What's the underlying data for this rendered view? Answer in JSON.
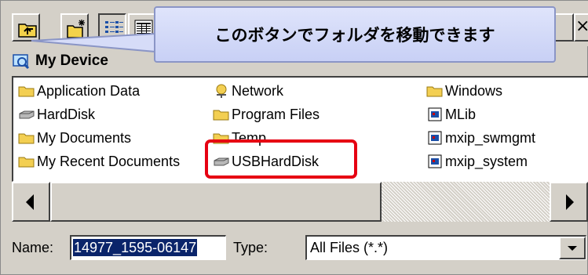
{
  "toolbar": {
    "buttons": [
      "up-folder-icon",
      "new-folder-icon",
      "list-view-icon",
      "details-view-icon"
    ],
    "close_label": "×"
  },
  "location": {
    "label": "My Device",
    "icon": "device-icon"
  },
  "files": [
    {
      "name": "Application Data",
      "icon": "folder-icon"
    },
    {
      "name": "HardDisk",
      "icon": "drive-icon"
    },
    {
      "name": "My Documents",
      "icon": "folder-icon"
    },
    {
      "name": "My Recent Documents",
      "icon": "folder-icon"
    },
    {
      "name": "Network",
      "icon": "network-icon"
    },
    {
      "name": "Program Files",
      "icon": "folder-icon"
    },
    {
      "name": "Temp",
      "icon": "folder-icon"
    },
    {
      "name": "USBHardDisk",
      "icon": "drive-icon"
    },
    {
      "name": "Windows",
      "icon": "folder-icon"
    },
    {
      "name": "MLib",
      "icon": "file-icon"
    },
    {
      "name": "mxip_swmgmt",
      "icon": "file-icon"
    },
    {
      "name": "mxip_system",
      "icon": "file-icon"
    }
  ],
  "bottom": {
    "name_label": "Name:",
    "name_value": "14977_1595-06147",
    "type_label": "Type:",
    "type_value": "All Files (*.*)"
  },
  "callout": {
    "text": "このボタンでフォルダを移動できます"
  },
  "colors": {
    "highlight": "#e60012",
    "selection": "#0a246a",
    "callout_bg": "#d3daf8"
  }
}
